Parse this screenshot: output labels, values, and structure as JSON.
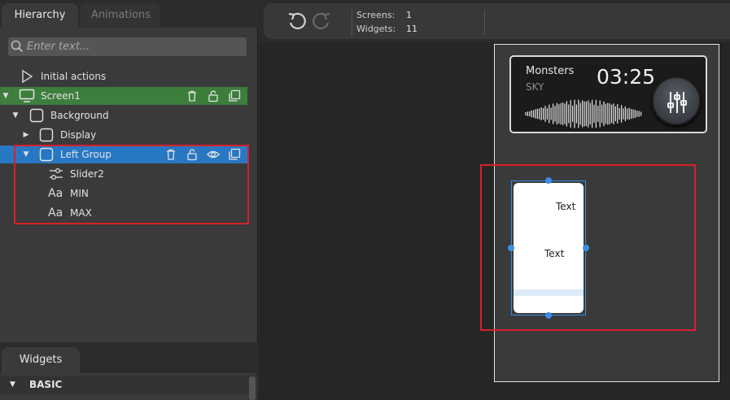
{
  "tabs": {
    "hierarchy": "Hierarchy",
    "animations": "Animations"
  },
  "search": {
    "placeholder": "Enter text..."
  },
  "tree": {
    "initial_actions": "Initial actions",
    "screen1": "Screen1",
    "background": "Background",
    "display": "Display",
    "left_group": "Left Group",
    "slider2": "Slider2",
    "min": "MIN",
    "max": "MAX"
  },
  "widgets_panel": {
    "tab": "Widgets",
    "section": "BASIC"
  },
  "toolbar": {
    "screens_label": "Screens:",
    "screens_value": "1",
    "widgets_label": "Widgets:",
    "widgets_value": "11"
  },
  "preview": {
    "title": "Monsters",
    "subtitle": "SKY",
    "time": "03:25",
    "text_top": "Text",
    "text_mid": "Text"
  },
  "colors": {
    "screen_row": "#3d7e3d",
    "selected_row": "#2877c3",
    "highlight": "#d6212b",
    "selection_handle": "#3a8ee6"
  },
  "icons": {
    "trash": "trash-icon",
    "lock": "unlock-icon",
    "eye": "eye-icon",
    "duplicate": "duplicate-icon",
    "undo": "undo-icon",
    "redo": "redo-icon"
  }
}
